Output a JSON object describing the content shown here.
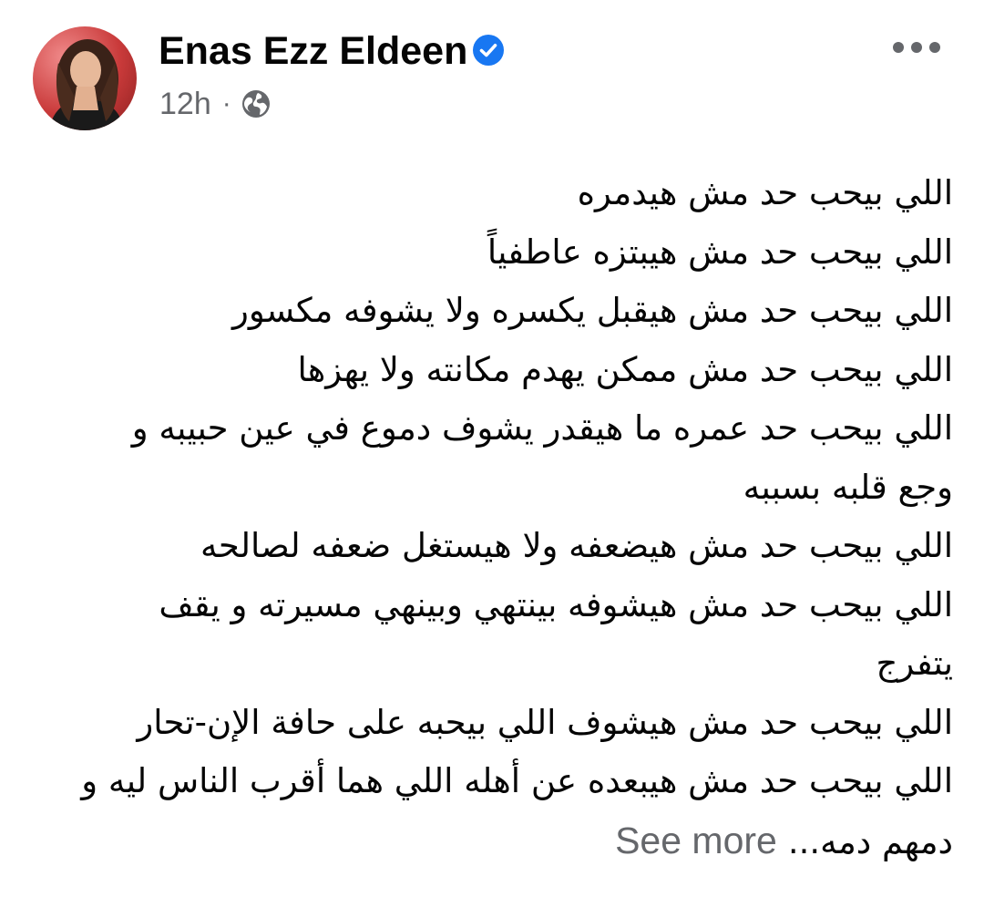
{
  "author": {
    "name": "Enas Ezz Eldeen",
    "verified": true
  },
  "meta": {
    "time": "12h",
    "separator": "·",
    "audience_icon": "globe-icon"
  },
  "menu": {
    "icon": "more-dots-icon"
  },
  "colors": {
    "text": "#050505",
    "secondary_text": "#65676b",
    "verified_blue": "#1877f2"
  },
  "post": {
    "lines": [
      "اللي بيحب حد مش هيدمره",
      "اللي بيحب حد مش هيبتزه عاطفياً",
      "اللي بيحب حد مش هيقبل يكسره ولا يشوفه مكسور",
      "اللي بيحب حد مش ممكن يهدم مكانته ولا يهزها",
      "اللي بيحب حد عمره ما هيقدر يشوف دموع في عين حبيبه و",
      "وجع قلبه بسببه",
      "اللي بيحب حد مش هيضعفه ولا هيستغل ضعفه لصالحه",
      "اللي بيحب حد مش هيشوفه بينتهي وبينهي مسيرته و يقف",
      "يتفرج",
      "اللي بيحب حد مش هيشوف اللي بيحبه على حافة الإن-تحار",
      "اللي بيحب حد مش هيبعده عن أهله اللي هما أقرب الناس ليه و"
    ],
    "truncated_line": "دمهم دمه...",
    "see_more_label": "See more"
  }
}
